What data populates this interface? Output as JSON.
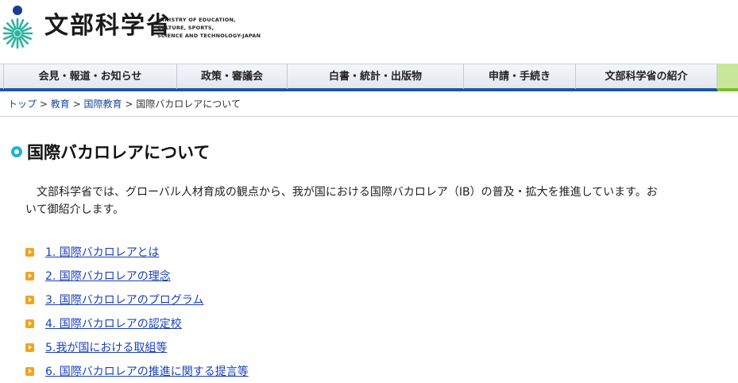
{
  "header": {
    "logo_jp": "文部科学省",
    "logo_en": [
      "MINISTRY OF EDUCATION,",
      "CULTURE, SPORTS,",
      "SCIENCE AND TECHNOLOGY-JAPAN"
    ]
  },
  "nav": {
    "items": [
      {
        "label": "会見・報道・お知らせ"
      },
      {
        "label": "政策・審議会"
      },
      {
        "label": "白書・統計・出版物"
      },
      {
        "label": "申請・手続き"
      },
      {
        "label": "文部科学省の紹介"
      }
    ],
    "accent_color": "#1e56a0",
    "extra_tab_color": "#c9e79b"
  },
  "breadcrumb": {
    "links": [
      "トップ",
      "教育",
      "国際教育"
    ],
    "separator": ">",
    "current": "国際バカロレアについて"
  },
  "page": {
    "title": "国際バカロレアについて",
    "intro": [
      "文部科学省では、グローバル人材育成の観点から、我が国における国際バカロレア（IB）の普及・拡大を推進しています。お",
      "いて御紹介します。"
    ],
    "links": [
      "1. 国際バカロレアとは",
      "2. 国際バカロレアの理念",
      "3. 国際バカロレアのプログラム",
      "4. 国際バカロレアの認定校",
      "5.我が国における取組等",
      "6. 国際バカロレアの推進に関する提言等"
    ],
    "title_icon": "circle-bullet-icon",
    "link_icon": "arrow-bullet-icon"
  }
}
